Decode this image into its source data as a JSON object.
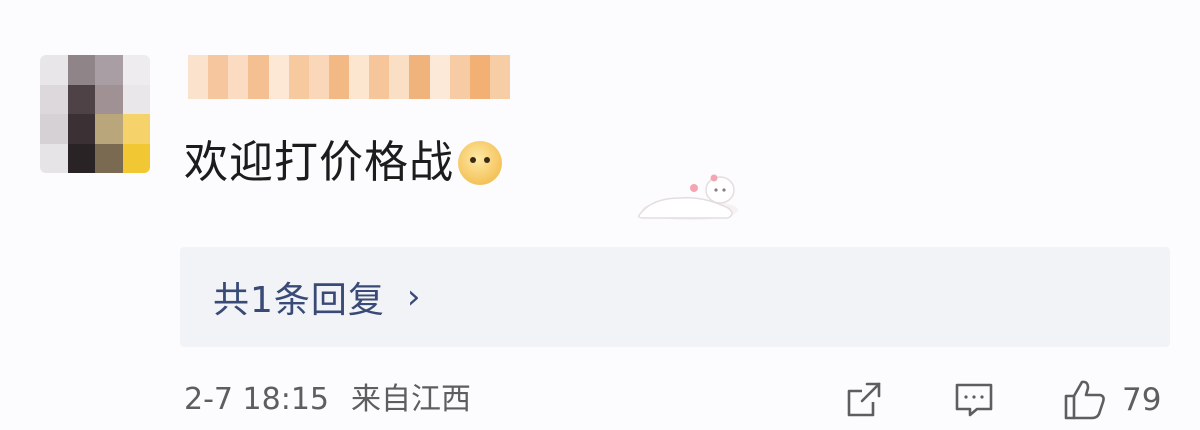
{
  "comment": {
    "text": "欢迎打价格战",
    "emoji": "doge-emoji"
  },
  "replies": {
    "label": "共1条回复",
    "chevron": "›"
  },
  "meta": {
    "time": "2-7 18:15",
    "location": "来自江西"
  },
  "actions": {
    "share_icon": "share-icon",
    "comment_icon": "comment-icon",
    "like_icon": "thumbs-up-icon",
    "like_count": "79"
  },
  "colors": {
    "background": "#fcfcfe",
    "reply_box": "#f2f3f7",
    "reply_text": "#3a4a76",
    "meta_text": "#5e5e5e"
  }
}
